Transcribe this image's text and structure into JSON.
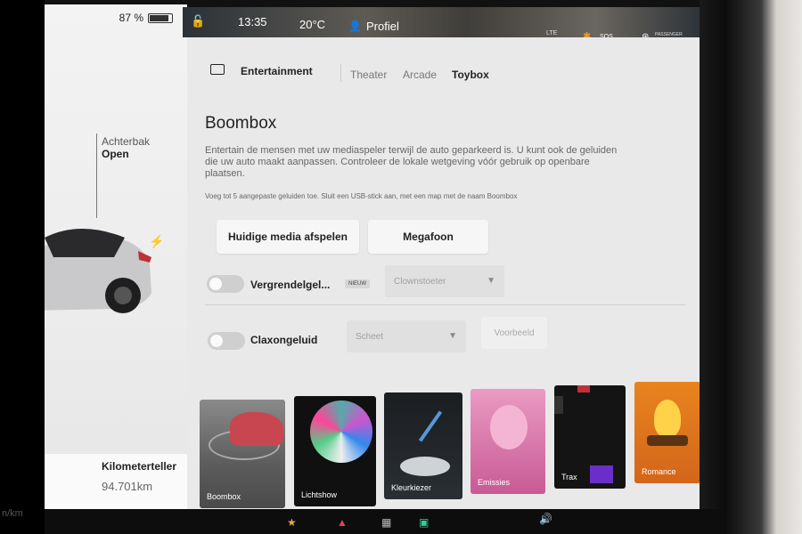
{
  "status": {
    "battery_percent": "87 %",
    "time": "13:35",
    "temperature": "20°C",
    "profile": "Profiel",
    "lte": "LTE",
    "sos": "SOS",
    "airbag_text": "PASSENGER AIRBAG ON"
  },
  "car": {
    "trunk_label": "Achterbak",
    "trunk_state": "Open",
    "odometer_label": "Kilometerteller",
    "odometer_value": "94.701",
    "odometer_unit": "km",
    "speed_unit": "n/km"
  },
  "entertainment": {
    "title": "Entertainment",
    "tabs": [
      {
        "label": "Theater",
        "active": false
      },
      {
        "label": "Arcade",
        "active": false
      },
      {
        "label": "Toybox",
        "active": true
      }
    ]
  },
  "boombox": {
    "title": "Boombox",
    "description": "Entertain de mensen met uw mediaspeler terwijl de auto geparkeerd is. U kunt ook de geluiden die uw auto maakt aanpassen. Controleer de lokale wetgeving vóór gebruik op openbare plaatsen.",
    "note": "Voeg tot 5 aangepaste geluiden toe. Sluit een USB-stick aan, met een map met de naam Boombox",
    "play_media_button": "Huidige media afspelen",
    "megaphone_button": "Megafoon",
    "lock_sound": {
      "label": "Vergrendelgel...",
      "badge": "NIEUW",
      "selected": "Clownstoeter",
      "enabled": false
    },
    "horn_sound": {
      "label": "Claxongeluid",
      "selected": "Scheet",
      "enabled": false,
      "preview_button": "Voorbeeld"
    }
  },
  "tiles": [
    {
      "label": "Boombox"
    },
    {
      "label": "Lichtshow"
    },
    {
      "label": "Kleurkiezer"
    },
    {
      "label": "Emissies"
    },
    {
      "label": "Trax"
    },
    {
      "label": "Romance"
    }
  ],
  "colors": {
    "panel_bg": "#e9e9ea",
    "tab_active": "#222222",
    "tab_inactive": "#777777"
  }
}
